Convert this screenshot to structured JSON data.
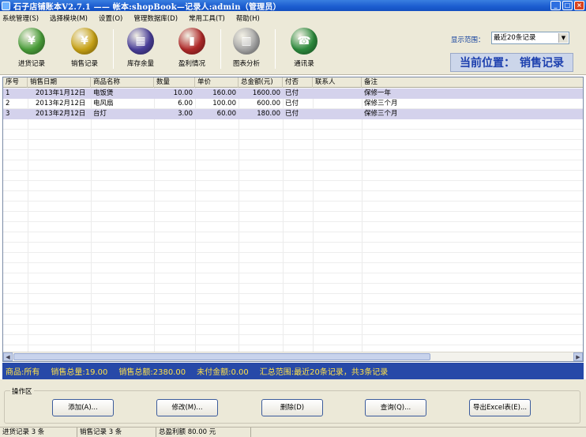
{
  "window": {
    "title": "石子店铺账本V2.7.1 —— 帐本:shopBook—记录人:admin（管理员）",
    "controls": [
      "_",
      "□",
      "×"
    ]
  },
  "menu": [
    "系统管理(S)",
    "选择模块(M)",
    "设置(O)",
    "管理数据库(D)",
    "常用工具(T)",
    "帮助(H)"
  ],
  "toolbar": {
    "buttons": [
      {
        "label": "进货记录",
        "icon": "purchase-record-icon",
        "glyph": "¥",
        "color": "#4a9e3a"
      },
      {
        "label": "销售记录",
        "icon": "sales-record-icon",
        "glyph": "¥",
        "color": "#c9a316"
      },
      {
        "label": "库存余量",
        "icon": "inventory-icon",
        "glyph": "▦",
        "color": "#4a3f9a"
      },
      {
        "label": "盈利情况",
        "icon": "profit-icon",
        "glyph": "▮",
        "color": "#b02a2a"
      },
      {
        "label": "图表分析",
        "icon": "chart-analysis-icon",
        "glyph": "▥",
        "color": "#a6a6a6"
      },
      {
        "label": "通讯录",
        "icon": "phone-book-icon",
        "glyph": "☎",
        "color": "#2d8b3d"
      }
    ],
    "range_label": "显示范围：",
    "range_value": "最近20条记录",
    "location_label": "当前位置：",
    "location_value": "销售记录"
  },
  "table": {
    "columns": [
      "序号",
      "销售日期",
      "商品名称",
      "数量",
      "单价",
      "总金额(元)",
      "付否",
      "联系人",
      "备注"
    ],
    "rows": [
      [
        "1",
        "2013年1月12日",
        "电饭煲",
        "10.00",
        "160.00",
        "1600.00",
        "已付",
        "",
        "保修一年"
      ],
      [
        "2",
        "2013年2月12日",
        "电风扇",
        "6.00",
        "100.00",
        "600.00",
        "已付",
        "",
        "保修三个月"
      ],
      [
        "3",
        "2013年2月12日",
        "台灯",
        "3.00",
        "60.00",
        "180.00",
        "已付",
        "",
        "保修三个月"
      ]
    ]
  },
  "summary": {
    "goods": "商品:所有",
    "total_qty": "销售总量:19.00",
    "total_amount": "销售总额:2380.00",
    "unpaid": "未付金额:0.00",
    "range": "汇总范围:最近20条记录，共3条记录"
  },
  "operations": {
    "legend": "操作区",
    "buttons": [
      "添加(A)...",
      "修改(M)...",
      "删除(D)",
      "查询(Q)...",
      "导出Excel表(E)..."
    ]
  },
  "status": [
    "进货记录 3 条",
    "销售记录 3 条",
    "总盈利额 80.00 元"
  ]
}
